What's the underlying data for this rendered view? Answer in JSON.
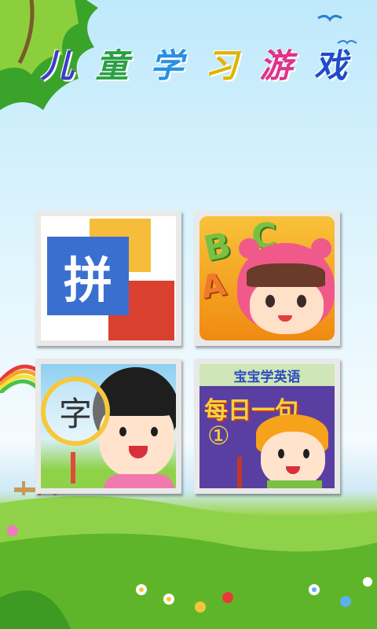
{
  "title": {
    "chars": [
      "儿",
      "童",
      "学",
      "习",
      "游",
      "戏"
    ]
  },
  "title_colors": [
    "#3b3fc4",
    "#2aa045",
    "#2b8fe0",
    "#e0b400",
    "#e0338a",
    "#1f4cc9"
  ],
  "games": [
    {
      "label": "拼",
      "icon": "pinyin-icon"
    },
    {
      "letters": [
        "B",
        "C",
        "A"
      ],
      "icon": "abc-bear-girl-icon"
    },
    {
      "label": "字",
      "icon": "chinese-character-girl-icon"
    },
    {
      "header": "宝宝学英语",
      "subtitle": "每日一句",
      "number": "①",
      "icon": "english-boy-icon"
    }
  ],
  "colors": {
    "pinyin_blue": "#3a6fd0",
    "pinyin_yellow": "#f6bd3a",
    "pinyin_red": "#d9402f",
    "abc_bg": "#f6a200",
    "english_bg": "#5a3fa2"
  }
}
